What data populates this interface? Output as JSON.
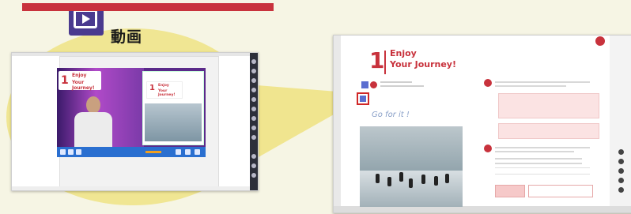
{
  "feature": {
    "label": "動画",
    "icon": "play-video-icon"
  },
  "video_player": {
    "lesson_number": "1",
    "lesson_title_line1": "Enjoy",
    "lesson_title_line2": "Your Journey!"
  },
  "textbook_page": {
    "lesson_number": "1",
    "lesson_title_line1": "Enjoy",
    "lesson_title_line2": "Your Journey!",
    "handwriting": "Go for it !"
  },
  "colors": {
    "accent_red": "#c8323c",
    "icon_purple": "#4a3a8f",
    "beam_yellow": "#eadb6a"
  }
}
